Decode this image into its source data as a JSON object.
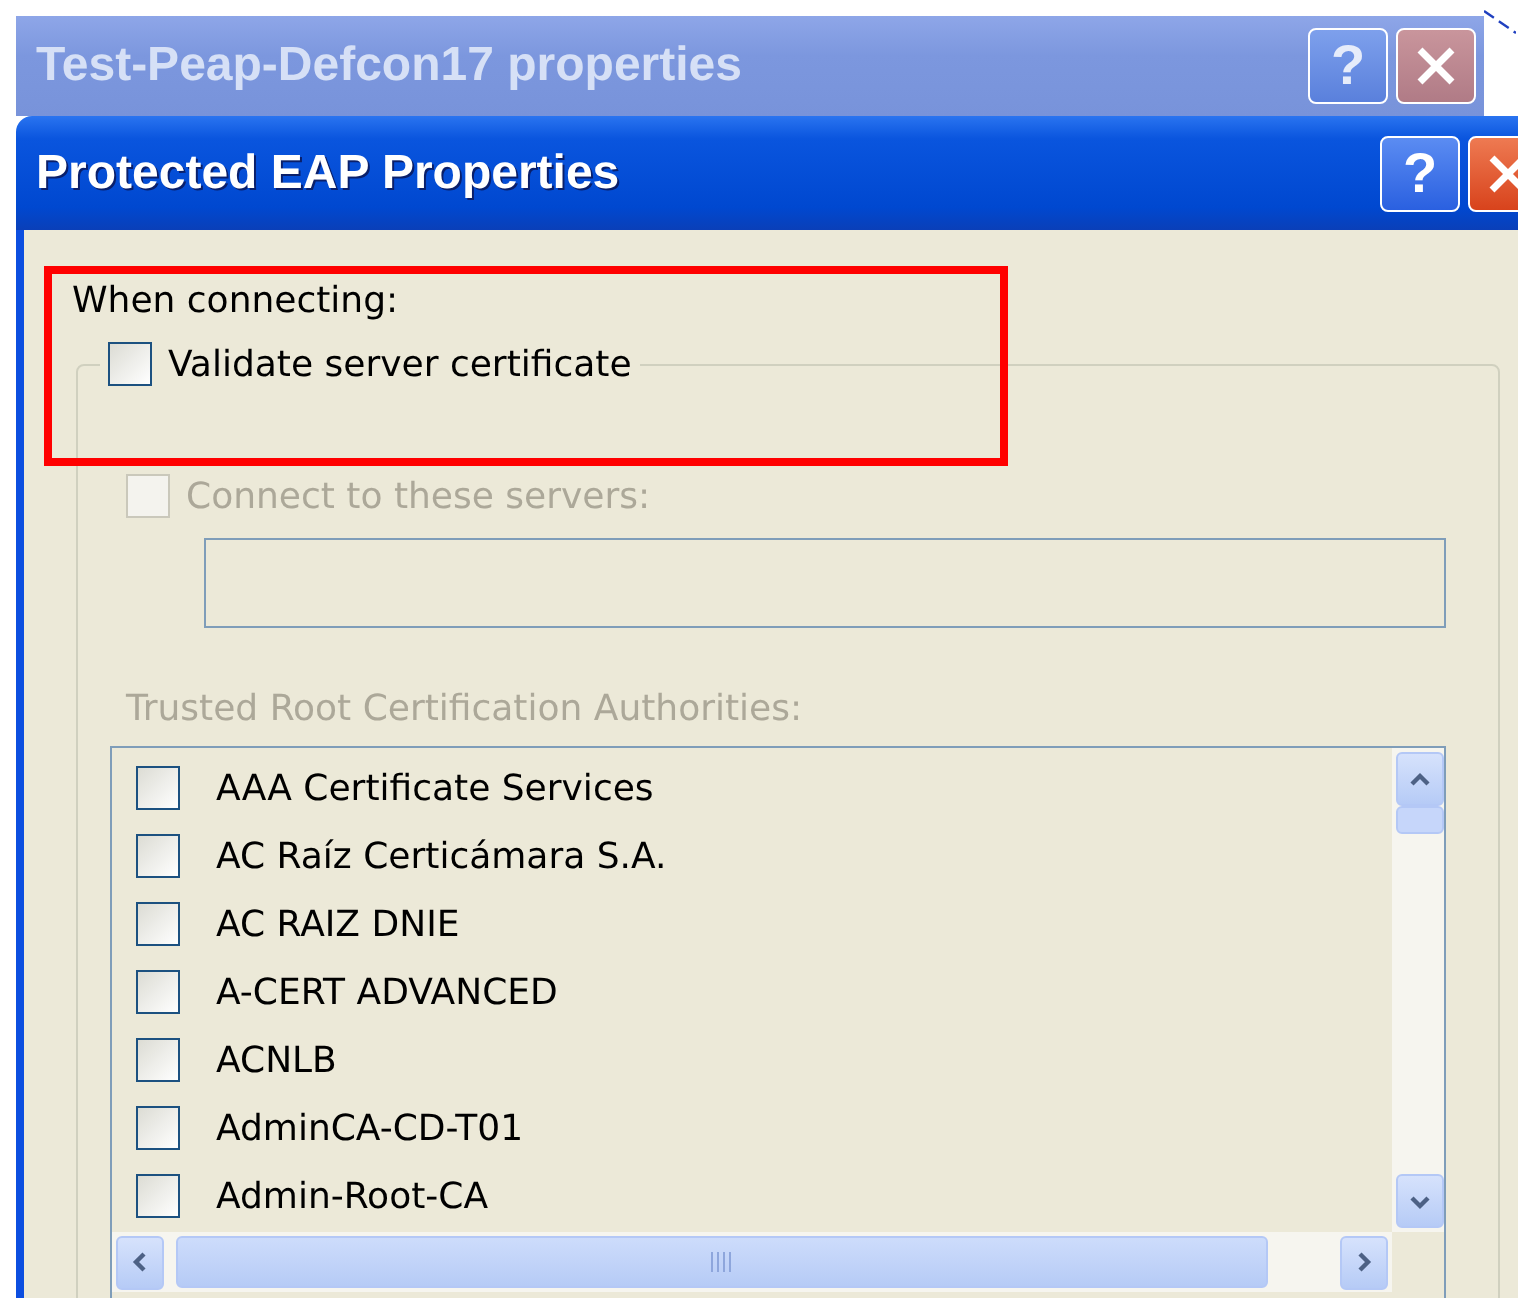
{
  "back_window": {
    "title": "Test-Peap-Defcon17 properties",
    "active": false,
    "help_label": "?"
  },
  "window": {
    "title": "Protected EAP Properties",
    "active": true,
    "help_label": "?"
  },
  "when_connecting": "When connecting:",
  "validate": {
    "label": "Validate server certificate",
    "checked": false,
    "disabled": false
  },
  "connect": {
    "label": "Connect to these servers:",
    "checked": false,
    "disabled": true
  },
  "trusted": {
    "label": "Trusted Root Certification Authorities:",
    "disabled": true
  },
  "authorities": [
    {
      "name": "AAA Certificate Services",
      "checked": false
    },
    {
      "name": "AC Raíz Certicámara S.A.",
      "checked": false
    },
    {
      "name": "AC RAIZ DNIE",
      "checked": false
    },
    {
      "name": "A-CERT ADVANCED",
      "checked": false
    },
    {
      "name": "ACNLB",
      "checked": false
    },
    {
      "name": "AdminCA-CD-T01",
      "checked": false
    },
    {
      "name": "Admin-Root-CA",
      "checked": false
    }
  ]
}
